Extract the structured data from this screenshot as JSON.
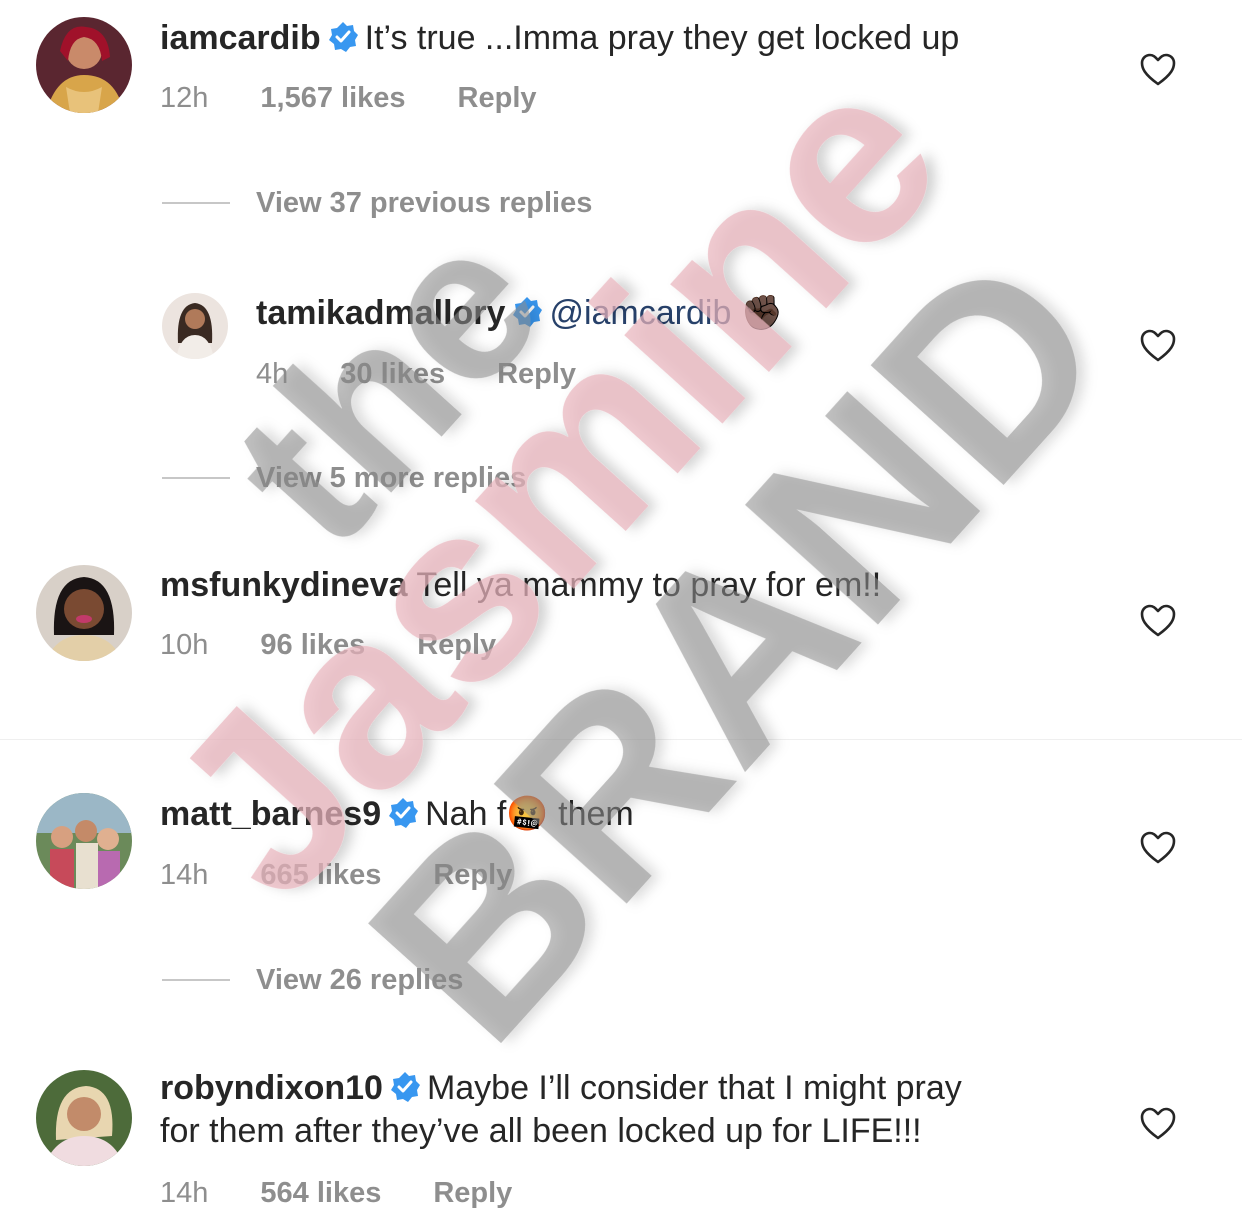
{
  "comments": [
    {
      "username": "iamcardib",
      "verified": true,
      "text": "It’s true ...Imma pray they get locked up",
      "time": "12h",
      "likes": "1,567 likes",
      "reply": "Reply"
    },
    {
      "username": "tamikadmallory",
      "verified": true,
      "mention": "@iamcardib",
      "emoji": "✊🏿",
      "time": "4h",
      "likes": "30 likes",
      "reply": "Reply"
    },
    {
      "username": "msfunkydineva",
      "verified": false,
      "text": "Tell ya mammy to pray for em!!",
      "time": "10h",
      "likes": "96 likes",
      "reply": "Reply"
    },
    {
      "username": "matt_barnes9",
      "verified": true,
      "text_before": "Nah f",
      "emoji": "🤬",
      "text_after": " them",
      "time": "14h",
      "likes": "665 likes",
      "reply": "Reply"
    },
    {
      "username": "robyndixon10",
      "verified": true,
      "text_line1": "Maybe I’ll consider that I might pray",
      "text_line2": "for them after they’ve all been locked up for LIFE!!!",
      "time": "14h",
      "likes": "564 likes",
      "reply": "Reply"
    }
  ],
  "view_replies": [
    "View 37 previous replies",
    "View 5 more replies",
    "View 26 replies"
  ],
  "watermark": {
    "line1": "the",
    "line2": "Jasmine",
    "line3": "BRAND"
  },
  "colors": {
    "verified": "#3897f0",
    "meta": "#8e8e8e",
    "mention": "#27416a",
    "watermark_pink": "#e8b4bc",
    "watermark_gray": "#8a8a8a"
  },
  "icons": {
    "like": "heart-outline-icon",
    "verified": "verified-badge-icon"
  }
}
